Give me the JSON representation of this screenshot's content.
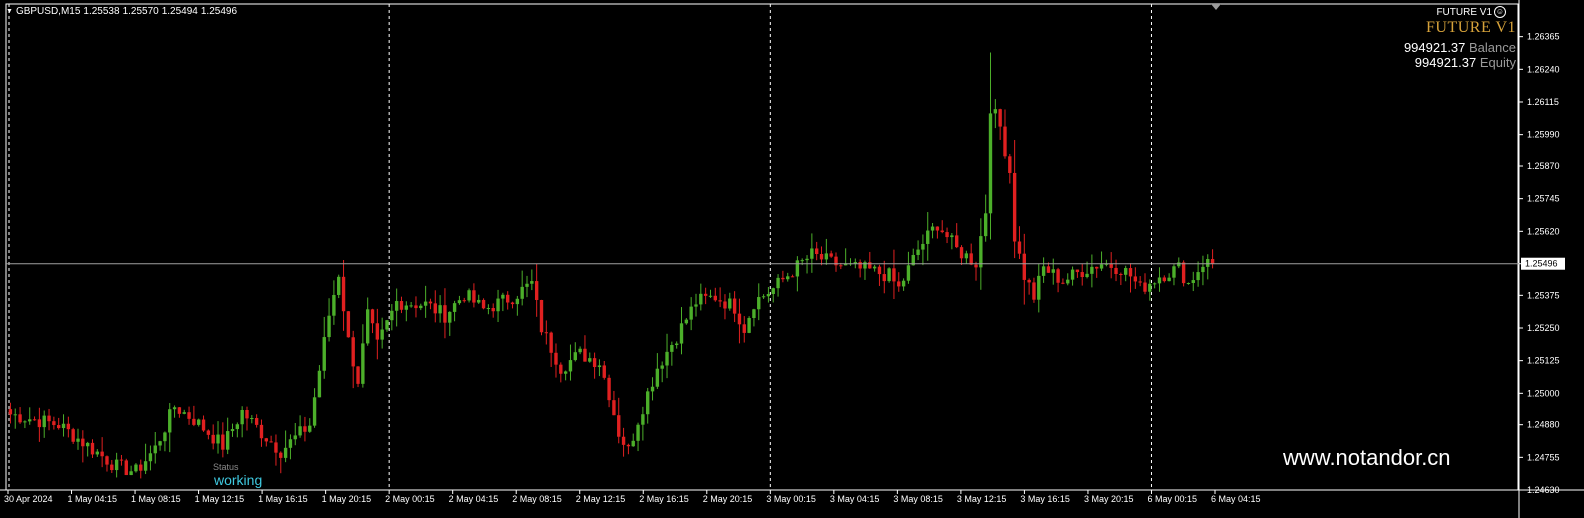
{
  "header": {
    "symbol": "GBPUSD,M15",
    "open": "1.25538",
    "high": "1.25570",
    "low": "1.25494",
    "close": "1.25496"
  },
  "ea": {
    "name": "FUTURE V1",
    "title": "FUTURE V1",
    "balance_value": "994921.37",
    "balance_label": "Balance",
    "equity_value": "994921.37",
    "equity_label": "Equity",
    "icon": "smile-icon"
  },
  "status": {
    "label": "Status",
    "value": "working"
  },
  "watermark": "www.notandor.cn",
  "colors": {
    "background": "#000000",
    "bull": "#4caf2a",
    "bear": "#e02020",
    "grid_separator": "#ffffff",
    "price_line": "#a0a0a0",
    "axis_text": "#ffffff",
    "status": "#3fc9e0",
    "ea_title": "#d6a23a"
  },
  "chart_data": {
    "type": "candlestick",
    "symbol": "GBPUSD",
    "timeframe": "M15",
    "current_price": "1.25496",
    "ylim": [
      1.2463,
      1.2649
    ],
    "y_ticks": [
      "1.26365",
      "1.26240",
      "1.26115",
      "1.25990",
      "1.25870",
      "1.25745",
      "1.25620",
      "1.25496",
      "1.25375",
      "1.25250",
      "1.25125",
      "1.25000",
      "1.24880",
      "1.24755",
      "1.24630"
    ],
    "x_ticks": [
      "30 Apr 2024",
      "1 May 04:15",
      "1 May 08:15",
      "1 May 12:15",
      "1 May 16:15",
      "1 May 20:15",
      "2 May 00:15",
      "2 May 04:15",
      "2 May 08:15",
      "2 May 12:15",
      "2 May 16:15",
      "2 May 20:15",
      "3 May 00:15",
      "3 May 04:15",
      "3 May 08:15",
      "3 May 12:15",
      "3 May 16:15",
      "3 May 20:15",
      "6 May 00:15",
      "6 May 04:15"
    ],
    "day_separators": [
      "1 May 00:00",
      "2 May 00:00",
      "3 May 00:00",
      "6 May 00:00"
    ],
    "close_path": [
      [
        0,
        1.2492
      ],
      [
        10,
        1.2488
      ],
      [
        16,
        1.248
      ],
      [
        22,
        1.2472
      ],
      [
        26,
        1.247
      ],
      [
        30,
        1.2479
      ],
      [
        34,
        1.2495
      ],
      [
        38,
        1.249
      ],
      [
        44,
        1.248
      ],
      [
        48,
        1.2493
      ],
      [
        52,
        1.2485
      ],
      [
        56,
        1.2478
      ],
      [
        62,
        1.2488
      ],
      [
        66,
        1.253
      ],
      [
        68,
        1.2546
      ],
      [
        70,
        1.252
      ],
      [
        72,
        1.2505
      ],
      [
        74,
        1.253
      ],
      [
        76,
        1.2518
      ],
      [
        80,
        1.2535
      ],
      [
        86,
        1.2534
      ],
      [
        90,
        1.253
      ],
      [
        94,
        1.2538
      ],
      [
        98,
        1.2532
      ],
      [
        104,
        1.2537
      ],
      [
        108,
        1.2542
      ],
      [
        110,
        1.2525
      ],
      [
        114,
        1.251
      ],
      [
        118,
        1.2515
      ],
      [
        122,
        1.2512
      ],
      [
        124,
        1.25
      ],
      [
        126,
        1.2485
      ],
      [
        128,
        1.2478
      ],
      [
        130,
        1.249
      ],
      [
        134,
        1.251
      ],
      [
        138,
        1.2522
      ],
      [
        142,
        1.2535
      ],
      [
        146,
        1.2537
      ],
      [
        150,
        1.2533
      ],
      [
        152,
        1.2525
      ],
      [
        154,
        1.2535
      ],
      [
        158,
        1.254
      ],
      [
        162,
        1.2547
      ],
      [
        166,
        1.2553
      ],
      [
        170,
        1.255
      ],
      [
        174,
        1.2548
      ],
      [
        178,
        1.2547
      ],
      [
        182,
        1.2545
      ],
      [
        184,
        1.254
      ],
      [
        188,
        1.2555
      ],
      [
        192,
        1.2565
      ],
      [
        196,
        1.2555
      ],
      [
        200,
        1.255
      ],
      [
        202,
        1.257
      ],
      [
        203,
        1.261
      ],
      [
        205,
        1.2602
      ],
      [
        207,
        1.2585
      ],
      [
        208,
        1.256
      ],
      [
        210,
        1.2545
      ],
      [
        212,
        1.2537
      ],
      [
        214,
        1.2548
      ],
      [
        218,
        1.2543
      ],
      [
        222,
        1.2547
      ],
      [
        226,
        1.255
      ],
      [
        230,
        1.2548
      ],
      [
        232,
        1.2545
      ],
      [
        234,
        1.254
      ],
      [
        238,
        1.2545
      ],
      [
        242,
        1.2548
      ],
      [
        244,
        1.2542
      ],
      [
        247,
        1.255
      ],
      [
        250,
        1.255
      ]
    ],
    "total_bars": 250
  }
}
